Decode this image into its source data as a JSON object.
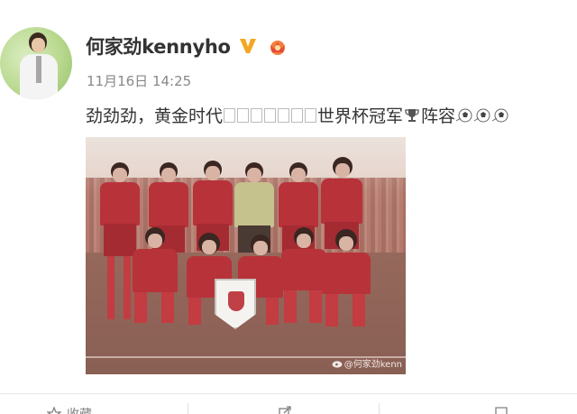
{
  "post": {
    "username": "何家劲kennyho",
    "timestamp": "11月16日 14:25",
    "text_part1": "劲劲劲，黄金时代",
    "text_part2": "世界杯冠军",
    "text_part3": "阵容",
    "badges": [
      "verified-v-icon",
      "vip-crown-icon"
    ],
    "icons": [
      "trophy-icon",
      "soccer-ball-icon"
    ]
  },
  "image": {
    "subject": "photo-soccer-team",
    "watermark": "@何家劲kenn"
  },
  "actions": {
    "favorite_label": "收藏",
    "forward_count": "",
    "comment_count": "",
    "like_count": "",
    "icons": [
      "star-icon",
      "forward-icon",
      "comment-icon",
      "like-icon"
    ]
  },
  "colors": {
    "text": "#333333",
    "meta": "#888888",
    "v_badge": "#f5a623",
    "jersey": "#b8323a"
  }
}
